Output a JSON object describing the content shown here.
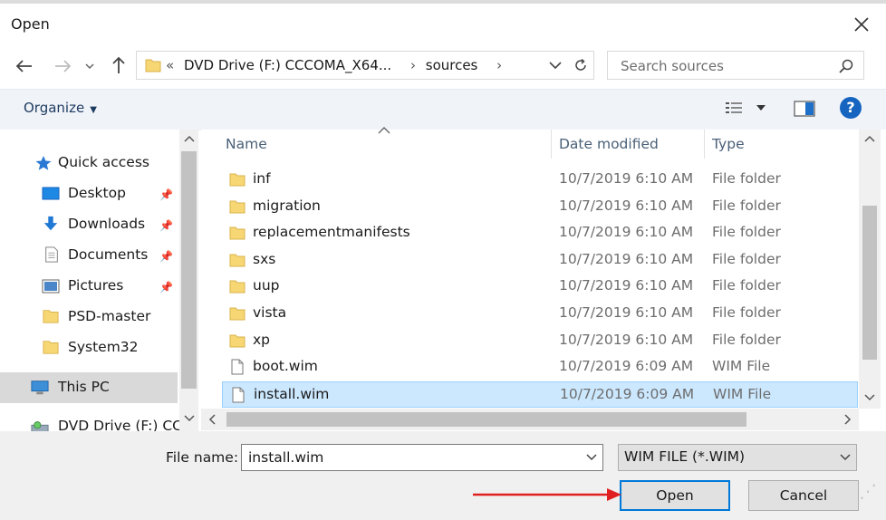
{
  "window": {
    "title": "Open"
  },
  "address_bar": {
    "prefix": "«",
    "segments": [
      "DVD Drive (F:) CCCOMA_X64...",
      "sources"
    ]
  },
  "search": {
    "placeholder": "Search sources"
  },
  "toolbar": {
    "organize_label": "Organize"
  },
  "sidebar": {
    "items": [
      {
        "label": "Quick access",
        "icon": "star-icon",
        "pinned": false
      },
      {
        "label": "Desktop",
        "icon": "desktop-icon",
        "pinned": true
      },
      {
        "label": "Downloads",
        "icon": "download-arrow-icon",
        "pinned": true
      },
      {
        "label": "Documents",
        "icon": "document-icon",
        "pinned": true
      },
      {
        "label": "Pictures",
        "icon": "pictures-icon",
        "pinned": true
      },
      {
        "label": "PSD-master",
        "icon": "folder-icon",
        "pinned": false
      },
      {
        "label": "System32",
        "icon": "folder-icon",
        "pinned": false
      },
      {
        "label": "This PC",
        "icon": "computer-icon",
        "pinned": false
      },
      {
        "label": "DVD Drive (F:) CCC",
        "icon": "dvd-drive-icon",
        "pinned": false
      }
    ]
  },
  "file_list": {
    "columns": [
      "Name",
      "Date modified",
      "Type"
    ],
    "rows": [
      {
        "name": "inf",
        "date": "10/7/2019 6:10 AM",
        "type": "File folder",
        "icon": "folder-icon",
        "selected": false
      },
      {
        "name": "migration",
        "date": "10/7/2019 6:10 AM",
        "type": "File folder",
        "icon": "folder-icon",
        "selected": false
      },
      {
        "name": "replacementmanifests",
        "date": "10/7/2019 6:10 AM",
        "type": "File folder",
        "icon": "folder-icon",
        "selected": false
      },
      {
        "name": "sxs",
        "date": "10/7/2019 6:10 AM",
        "type": "File folder",
        "icon": "folder-icon",
        "selected": false
      },
      {
        "name": "uup",
        "date": "10/7/2019 6:10 AM",
        "type": "File folder",
        "icon": "folder-icon",
        "selected": false
      },
      {
        "name": "vista",
        "date": "10/7/2019 6:10 AM",
        "type": "File folder",
        "icon": "folder-icon",
        "selected": false
      },
      {
        "name": "xp",
        "date": "10/7/2019 6:10 AM",
        "type": "File folder",
        "icon": "folder-icon",
        "selected": false
      },
      {
        "name": "boot.wim",
        "date": "10/7/2019 6:09 AM",
        "type": "WIM File",
        "icon": "file-icon",
        "selected": false
      },
      {
        "name": "install.wim",
        "date": "10/7/2019 6:09 AM",
        "type": "WIM File",
        "icon": "file-icon",
        "selected": true
      }
    ]
  },
  "footer": {
    "file_name_label": "File name:",
    "file_name_value": "install.wim",
    "file_type_value": "WIM FILE (*.WIM)",
    "open_label": "Open",
    "cancel_label": "Cancel"
  },
  "colors": {
    "folder": "#f7d774",
    "selection": "#cce8ff",
    "accent": "#0078d7",
    "annotation_arrow": "#e02020"
  }
}
